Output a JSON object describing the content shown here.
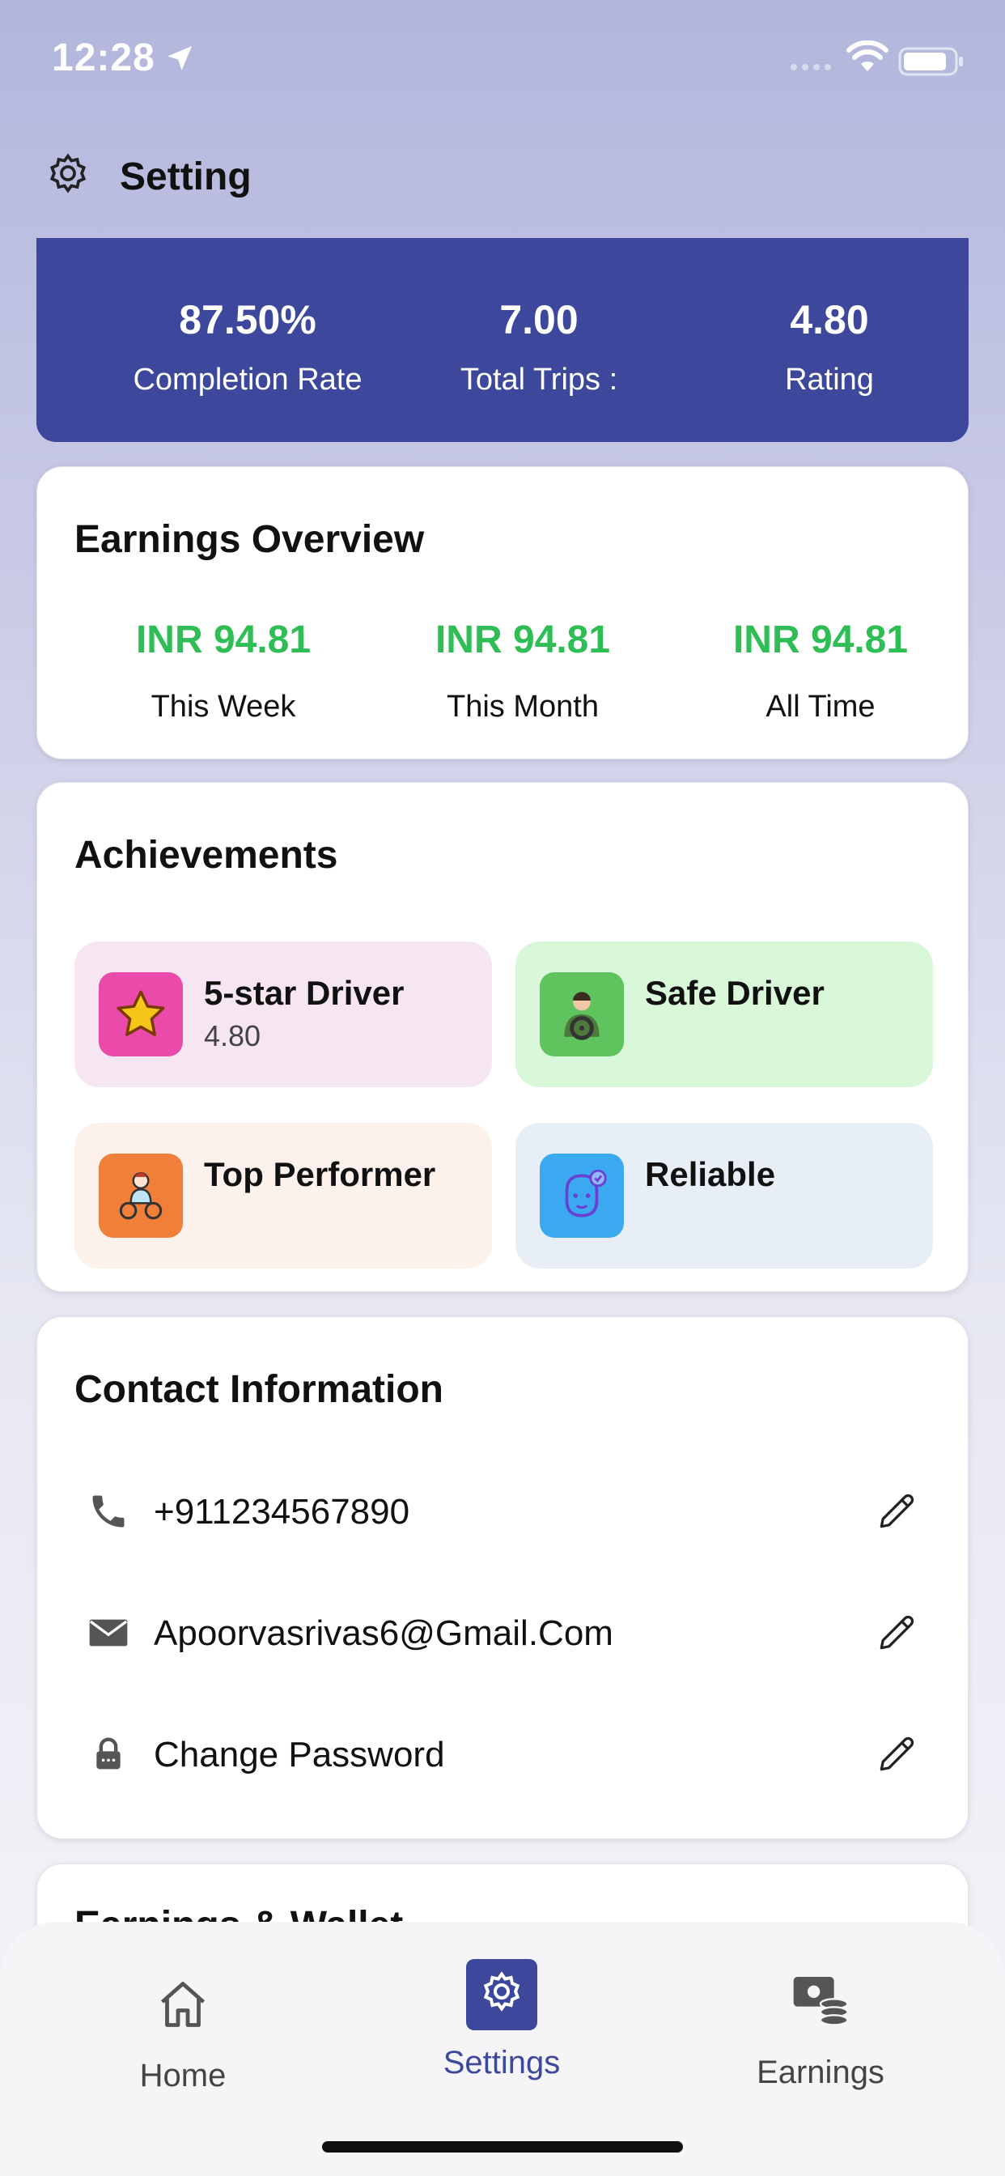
{
  "status_bar": {
    "time": "12:28"
  },
  "header": {
    "title": "Setting"
  },
  "stats": [
    {
      "value": "87.50%",
      "label": "Completion Rate"
    },
    {
      "value": "7.00",
      "label": "Total Trips :"
    },
    {
      "value": "4.80",
      "label": "Rating"
    }
  ],
  "earnings": {
    "title": "Earnings Overview",
    "items": [
      {
        "amount": "INR 94.81",
        "period": "This Week"
      },
      {
        "amount": "INR 94.81",
        "period": "This Month"
      },
      {
        "amount": "INR 94.81",
        "period": "All Time"
      }
    ]
  },
  "achievements": {
    "title": "Achievements",
    "items": [
      {
        "title": "5-star Driver",
        "subtitle": "4.80",
        "icon": "star-icon",
        "bg": "#f5e6f1",
        "icon_bg": "#ea4aa9"
      },
      {
        "title": "Safe Driver",
        "subtitle": "",
        "icon": "steering-driver-icon",
        "bg": "#d8f8d9",
        "icon_bg": "#5fc45d"
      },
      {
        "title": "Top Performer",
        "subtitle": "",
        "icon": "cyclist-icon",
        "bg": "#fdf1ec",
        "icon_bg": "#f07f3a"
      },
      {
        "title": "Reliable",
        "subtitle": "",
        "icon": "face-badge-icon",
        "bg": "#e7eef5",
        "icon_bg": "#3aa9ef"
      }
    ]
  },
  "contact": {
    "title": "Contact Information",
    "phone": "+911234567890",
    "email": "Apoorvasrivas6@Gmail.Com",
    "password": "Change Password"
  },
  "wallet": {
    "title": "Earnings & Wallet"
  },
  "tabs": [
    {
      "label": "Home",
      "icon": "home-icon"
    },
    {
      "label": "Settings",
      "icon": "gear-icon"
    },
    {
      "label": "Earnings",
      "icon": "wallet-coins-icon"
    }
  ],
  "colors": {
    "accent": "#3d489c",
    "earnings_green": "#2fbe55"
  }
}
